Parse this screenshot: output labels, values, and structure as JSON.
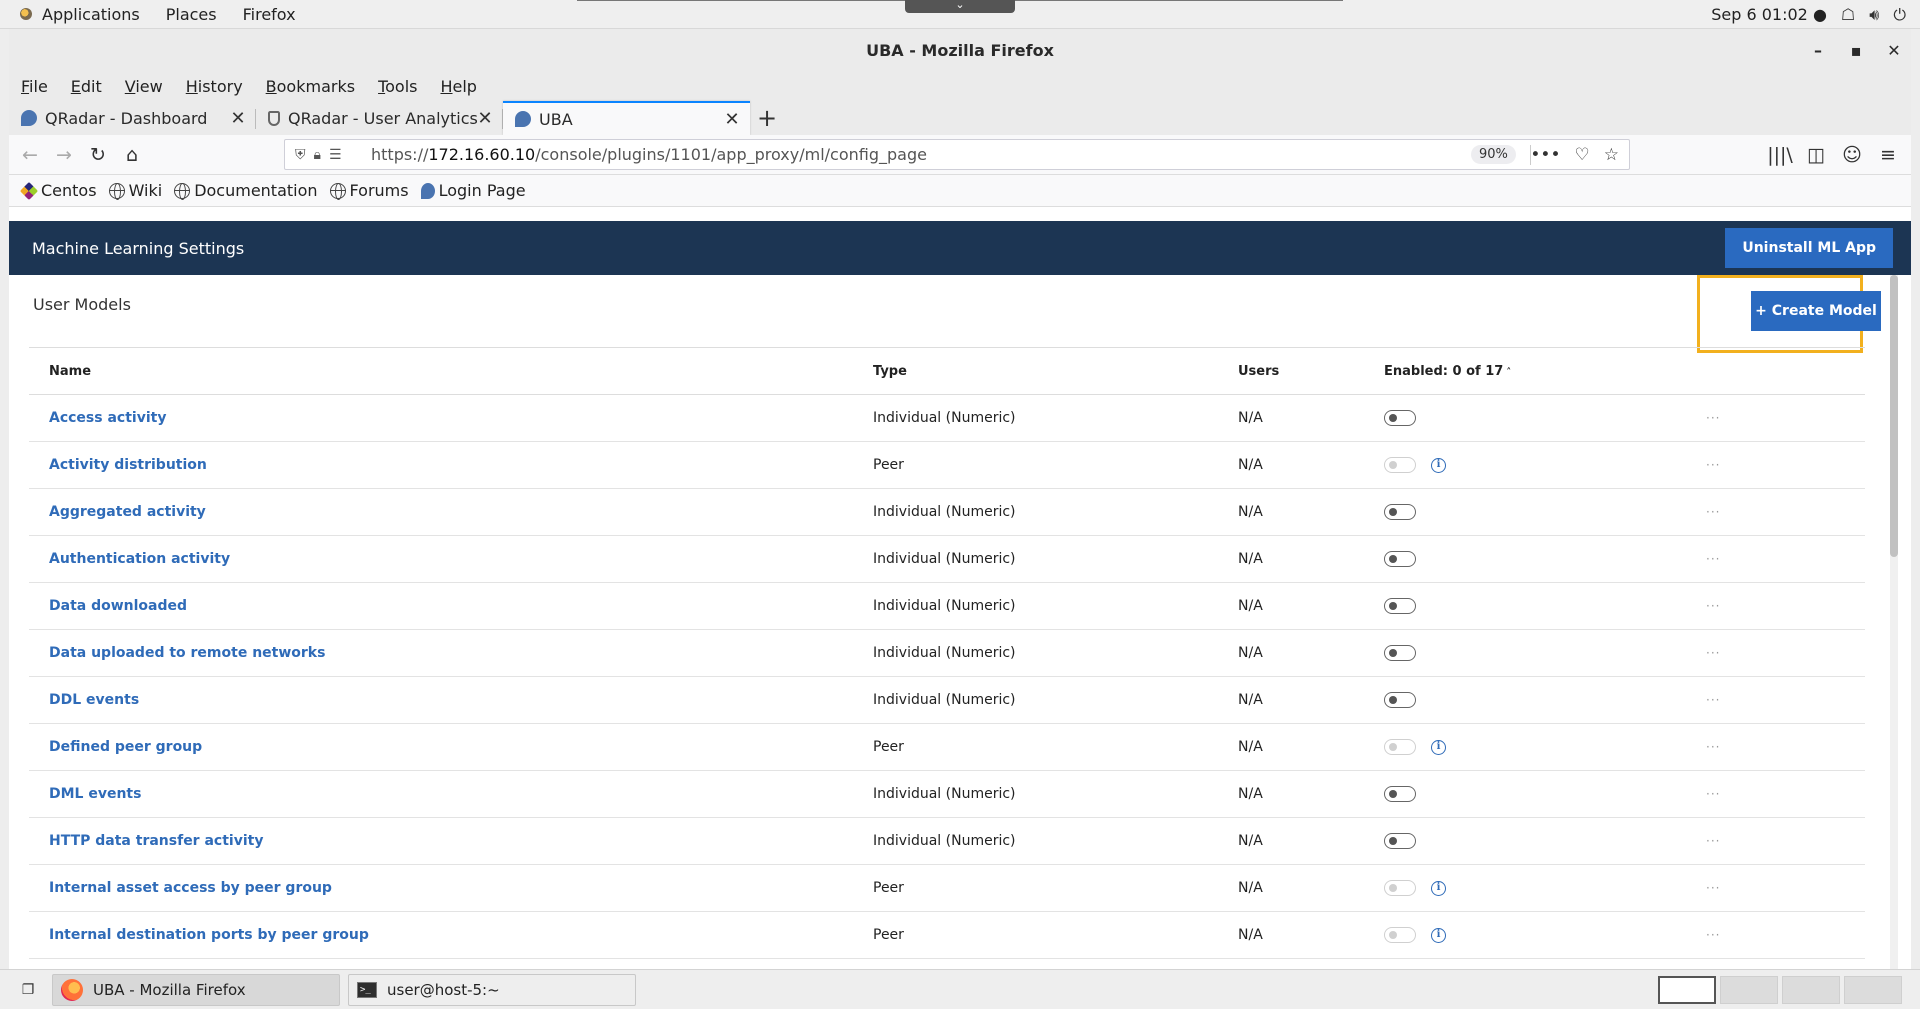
{
  "topbar": {
    "applications": "Applications",
    "places": "Places",
    "firefox": "Firefox",
    "datetime": "Sep 6  01:02 ●",
    "handle_glyph": "⌄"
  },
  "window": {
    "title": "UBA - Mozilla Firefox",
    "minimize": "–",
    "maximize": "▪",
    "close": "✕"
  },
  "menubar": [
    "File",
    "Edit",
    "View",
    "History",
    "Bookmarks",
    "Tools",
    "Help"
  ],
  "tabs": [
    {
      "label": "QRadar - Dashboard",
      "close": "✕",
      "active": false,
      "icon": "qradar-icon"
    },
    {
      "label": "QRadar - User Analytics",
      "close": "✕",
      "active": false,
      "icon": "shield-icon"
    },
    {
      "label": "UBA",
      "close": "✕",
      "active": true,
      "icon": "qradar-icon"
    }
  ],
  "newtab": "+",
  "navbar": {
    "back": "←",
    "forward": "→",
    "reload": "↻",
    "home": "⌂",
    "url_prefix": "https://",
    "url_host": "172.16.60.10",
    "url_path": "/console/plugins/1101/app_proxy/ml/config_page",
    "zoom": "90%",
    "more": "•••",
    "pocket": "♡",
    "star": "☆",
    "library": "|||\\",
    "sidebar": "◫",
    "account": "☺",
    "menu": "≡"
  },
  "bookmarks": [
    {
      "label": "Centos",
      "icon": "centos-icon"
    },
    {
      "label": "Wiki",
      "icon": "globe-icon"
    },
    {
      "label": "Documentation",
      "icon": "globe-icon"
    },
    {
      "label": "Forums",
      "icon": "globe-icon"
    },
    {
      "label": "Login Page",
      "icon": "qradar-icon"
    }
  ],
  "page": {
    "header_title": "Machine Learning Settings",
    "uninstall_label": "Uninstall ML App",
    "section_title": "User Models",
    "create_label": "+ Create Model",
    "columns": {
      "name": "Name",
      "type": "Type",
      "users": "Users",
      "enabled": "Enabled: 0 of 17",
      "sort": "˄"
    },
    "more_glyph": "···",
    "info_glyph": "i",
    "rows": [
      {
        "name": "Access activity",
        "type": "Individual (Numeric)",
        "users": "N/A",
        "toggle": "available",
        "info": false
      },
      {
        "name": "Activity distribution",
        "type": "Peer",
        "users": "N/A",
        "toggle": "disabled",
        "info": true
      },
      {
        "name": "Aggregated activity",
        "type": "Individual (Numeric)",
        "users": "N/A",
        "toggle": "available",
        "info": false
      },
      {
        "name": "Authentication activity",
        "type": "Individual (Numeric)",
        "users": "N/A",
        "toggle": "available",
        "info": false
      },
      {
        "name": "Data downloaded",
        "type": "Individual (Numeric)",
        "users": "N/A",
        "toggle": "available",
        "info": false
      },
      {
        "name": "Data uploaded to remote networks",
        "type": "Individual (Numeric)",
        "users": "N/A",
        "toggle": "available",
        "info": false
      },
      {
        "name": "DDL events",
        "type": "Individual (Numeric)",
        "users": "N/A",
        "toggle": "available",
        "info": false
      },
      {
        "name": "Defined peer group",
        "type": "Peer",
        "users": "N/A",
        "toggle": "disabled",
        "info": true
      },
      {
        "name": "DML events",
        "type": "Individual (Numeric)",
        "users": "N/A",
        "toggle": "available",
        "info": false
      },
      {
        "name": "HTTP data transfer activity",
        "type": "Individual (Numeric)",
        "users": "N/A",
        "toggle": "available",
        "info": false
      },
      {
        "name": "Internal asset access by peer group",
        "type": "Peer",
        "users": "N/A",
        "toggle": "disabled",
        "info": true
      },
      {
        "name": "Internal destination ports by peer group",
        "type": "Peer",
        "users": "N/A",
        "toggle": "disabled",
        "info": true
      }
    ]
  },
  "taskbar": {
    "show_desktop": "❐",
    "items": [
      {
        "label": "UBA - Mozilla Firefox",
        "active": true,
        "icon": "firefox-icon"
      },
      {
        "label": "user@host-5:~",
        "active": false,
        "icon": "terminal-icon"
      }
    ],
    "terminal_glyph": ">_"
  }
}
